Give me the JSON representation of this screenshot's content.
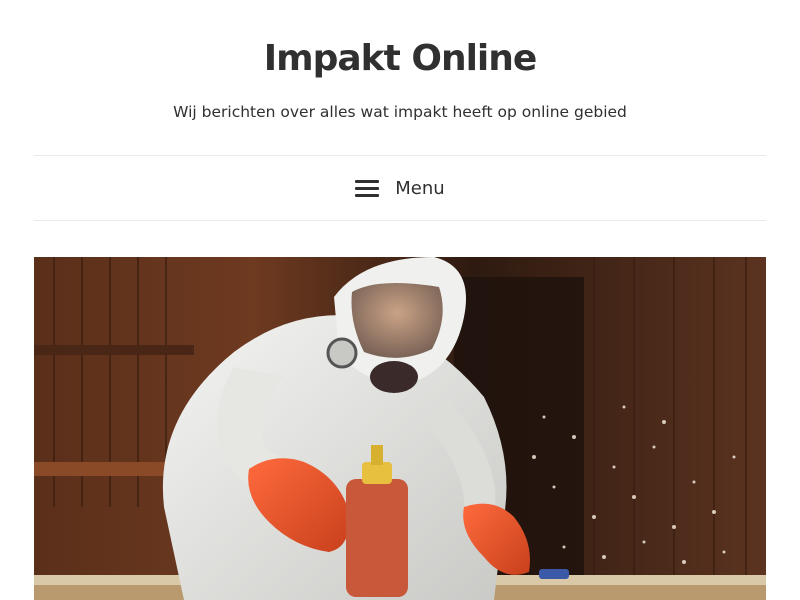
{
  "site": {
    "title": "Impakt Online",
    "description": "Wij berichten over alles wat impakt heeft op online gebied"
  },
  "navigation": {
    "menu_label": "Menu",
    "menu_icon": "hamburger-icon"
  },
  "featured": {
    "image_subject": "worker in white protective suit and face shield with orange gloves working on a table in a wooden workshop"
  }
}
